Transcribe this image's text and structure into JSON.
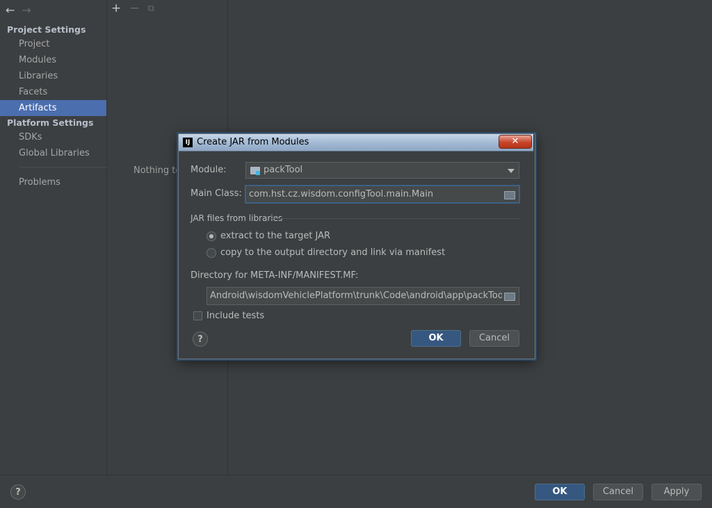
{
  "nav": {
    "back_glyph": "←",
    "forward_glyph": "→"
  },
  "sidebar": {
    "project_settings_header": "Project Settings",
    "project_items": [
      {
        "label": "Project"
      },
      {
        "label": "Modules"
      },
      {
        "label": "Libraries"
      },
      {
        "label": "Facets"
      },
      {
        "label": "Artifacts",
        "selected": true
      }
    ],
    "platform_settings_header": "Platform Settings",
    "platform_items": [
      {
        "label": "SDKs"
      },
      {
        "label": "Global Libraries"
      }
    ],
    "problems_label": "Problems"
  },
  "toolbar": {
    "add_glyph": "+",
    "remove_glyph": "−",
    "copy_glyph": "⧉"
  },
  "middle": {
    "empty_text": "Nothing to"
  },
  "bottom": {
    "help": "?",
    "ok": "OK",
    "cancel": "Cancel",
    "apply": "Apply"
  },
  "dialog": {
    "title": "Create JAR from Modules",
    "app_icon_text": "IJ",
    "close_glyph": "✕",
    "module_label": "Module:",
    "module_value": "packTool",
    "main_class_label": "Main Class:",
    "main_class_value": "com.hst.cz.wisdom.configTool.main.Main",
    "jar_group_label": "JAR files from libraries",
    "radio_extract": "extract to the target JAR",
    "radio_copy": "copy to the output directory and link via manifest",
    "selected_radio": "extract",
    "manifest_label": "Directory for META-INF/MANIFEST.MF:",
    "manifest_value": "Android\\wisdomVehiclePlatform\\trunk\\Code\\android\\app\\packTool\\src",
    "include_tests_label": "Include tests",
    "include_tests_checked": false,
    "help": "?",
    "ok": "OK",
    "cancel": "Cancel"
  },
  "colors": {
    "background": "#3c3f41",
    "selection": "#4b6eaf",
    "primary_button": "#365880",
    "focus_border": "#3d6185"
  }
}
